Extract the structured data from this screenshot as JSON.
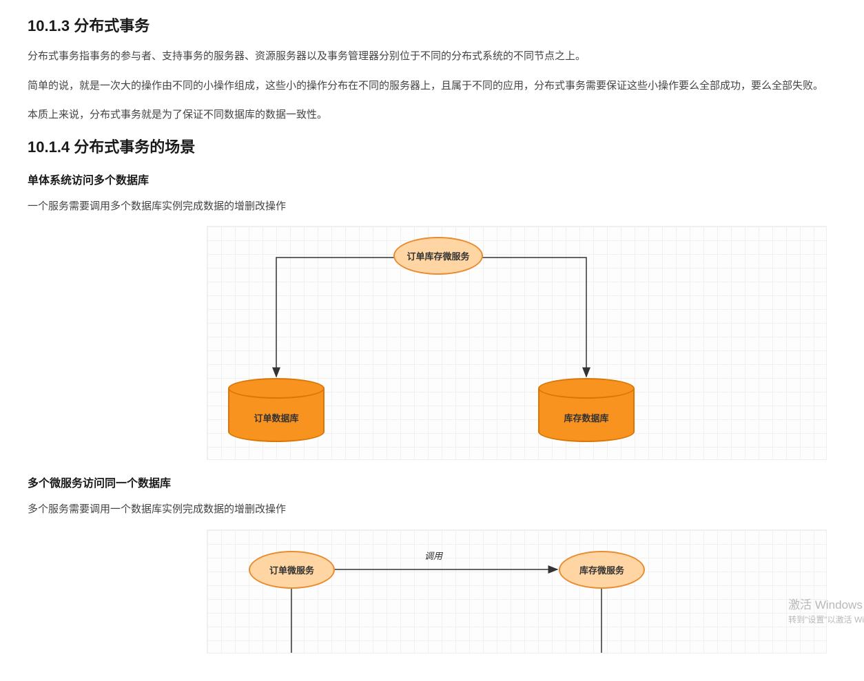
{
  "section1": {
    "heading": "10.1.3 分布式事务",
    "p1": "分布式事务指事务的参与者、支持事务的服务器、资源服务器以及事务管理器分别位于不同的分布式系统的不同节点之上。",
    "p2": "简单的说，就是一次大的操作由不同的小操作组成，这些小的操作分布在不同的服务器上，且属于不同的应用，分布式事务需要保证这些小操作要么全部成功，要么全部失败。",
    "p3": "本质上来说，分布式事务就是为了保证不同数据库的数据一致性。"
  },
  "section2": {
    "heading": "10.1.4 分布式事务的场景",
    "sub1_title": "单体系统访问多个数据库",
    "sub1_text": "一个服务需要调用多个数据库实例完成数据的增删改操作",
    "sub2_title": "多个微服务访问同一个数据库",
    "sub2_text": "多个服务需要调用一个数据库实例完成数据的增删改操作"
  },
  "diagram1": {
    "top_node": "订单库存微服务",
    "left_db": "订单数据库",
    "right_db": "库存数据库"
  },
  "diagram2": {
    "left_node": "订单微服务",
    "right_node": "库存微服务",
    "edge_label": "调用"
  },
  "watermark": {
    "title": "激活 Windows",
    "subtitle": "转到\"设置\"以激活 Wi"
  }
}
